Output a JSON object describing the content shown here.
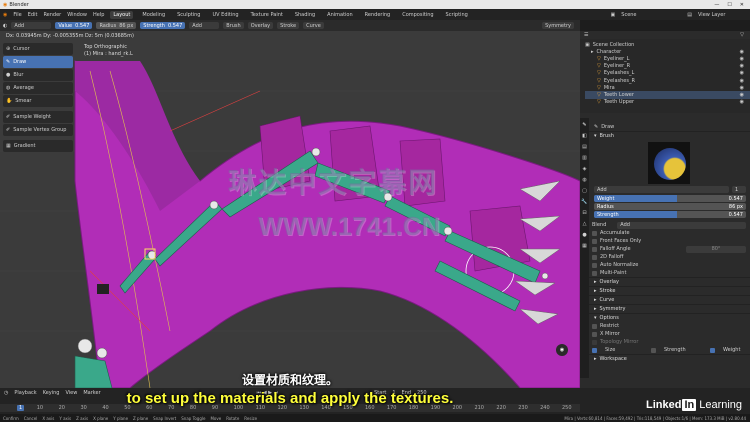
{
  "titlebar": {
    "app": "Blender"
  },
  "menubar": {
    "menus": [
      "File",
      "Edit",
      "Render",
      "Window",
      "Help"
    ],
    "workspaces": [
      "Layout",
      "Modeling",
      "Sculpting",
      "UV Editing",
      "Texture Paint",
      "Shading",
      "Animation",
      "Rendering",
      "Compositing",
      "Scripting"
    ],
    "scene": "Scene",
    "view_layer": "View Layer"
  },
  "toolheader": {
    "mode": "Add",
    "value_label": "Value",
    "value": "0.547",
    "radius_label": "Radius",
    "radius": "86 px",
    "strength_label": "Strength",
    "strength": "0.547",
    "blend": "Add",
    "brush": "Brush",
    "overlay": "Overlay",
    "stroke": "Stroke",
    "curve": "Curve",
    "symmetry": "Symmetry"
  },
  "viewport": {
    "readout": "Dx: 0.03945m  Dy: -0.005355m  Dz: 5m (0.03685m)",
    "view_name": "Top Orthographic",
    "object_name": "(1) Mira : hand_rk.L"
  },
  "tools": [
    "Cursor",
    "Draw",
    "Blur",
    "Average",
    "Smear",
    "Sample Weight",
    "Sample Vertex Group",
    "Gradient"
  ],
  "outliner": {
    "title": "Scene Collection",
    "items": [
      "Character",
      "Eyeliner_L",
      "Eyeliner_R",
      "Eyelashes_L",
      "Eyelashes_R",
      "Mira",
      "Teeth Lower",
      "Teeth Upper"
    ]
  },
  "properties": {
    "brush_name": "Draw",
    "brush_section": "Brush",
    "mode": "Add",
    "mode_value": "1",
    "weight_label": "Weight",
    "weight": "0.547",
    "weight_frac": 0.547,
    "radius_label": "Radius",
    "radius": "86 px",
    "strength_label": "Strength",
    "strength": "0.547",
    "strength_frac": 0.547,
    "blend_label": "Blend",
    "blend": "Add",
    "options": [
      "Accumulate",
      "Front Faces Only",
      "Falloff Angle",
      "2D Falloff",
      "Auto Normalize",
      "Multi-Paint"
    ],
    "falloff_value": "80°",
    "sections": [
      "Overlay",
      "Stroke",
      "Curve",
      "Symmetry",
      "Options"
    ],
    "options_list": [
      "Restrict",
      "X Mirror",
      "Topology Mirror"
    ],
    "bottom_toggles": [
      "Size",
      "Strength",
      "Weight"
    ],
    "workspace": "Workspace"
  },
  "timeline": {
    "menus": [
      "Playback",
      "Keying",
      "View",
      "Marker"
    ],
    "ticks": [
      "1",
      "10",
      "20",
      "30",
      "40",
      "50",
      "60",
      "70",
      "80",
      "90",
      "100",
      "110",
      "120",
      "130",
      "140",
      "150",
      "160",
      "170",
      "180",
      "190",
      "200",
      "210",
      "220",
      "230",
      "240",
      "250"
    ],
    "start_label": "Start",
    "start": "1",
    "end_label": "End",
    "end": "250"
  },
  "statusbar": {
    "items": [
      "Confirm",
      "Cancel",
      "X axis",
      "Y axis",
      "Z axis",
      "X plane",
      "Y plane",
      "Z plane",
      "Snap Invert",
      "Snap Toggle",
      "Move",
      "Rotate",
      "Resize"
    ],
    "stats": "Mira | Verts:60,814 | Faces:59,492 | Tris:118,549 | Objects:1/6 | Mem: 173.3 MiB | v2.80.44"
  },
  "watermark": {
    "cn": "琳达中文字幕网",
    "url": "WWW.1741.CN"
  },
  "subtitles": {
    "cn": "设置材质和纹理。",
    "en": "to set up the materials and apply the textures."
  },
  "branding": {
    "left": "Linked",
    "right": "In",
    "suffix": "Learning"
  },
  "colors": {
    "accent": "#4772b3",
    "mesh": "#b12db7",
    "bones": "#3aa88a",
    "subtitle": "#ffff3a"
  }
}
